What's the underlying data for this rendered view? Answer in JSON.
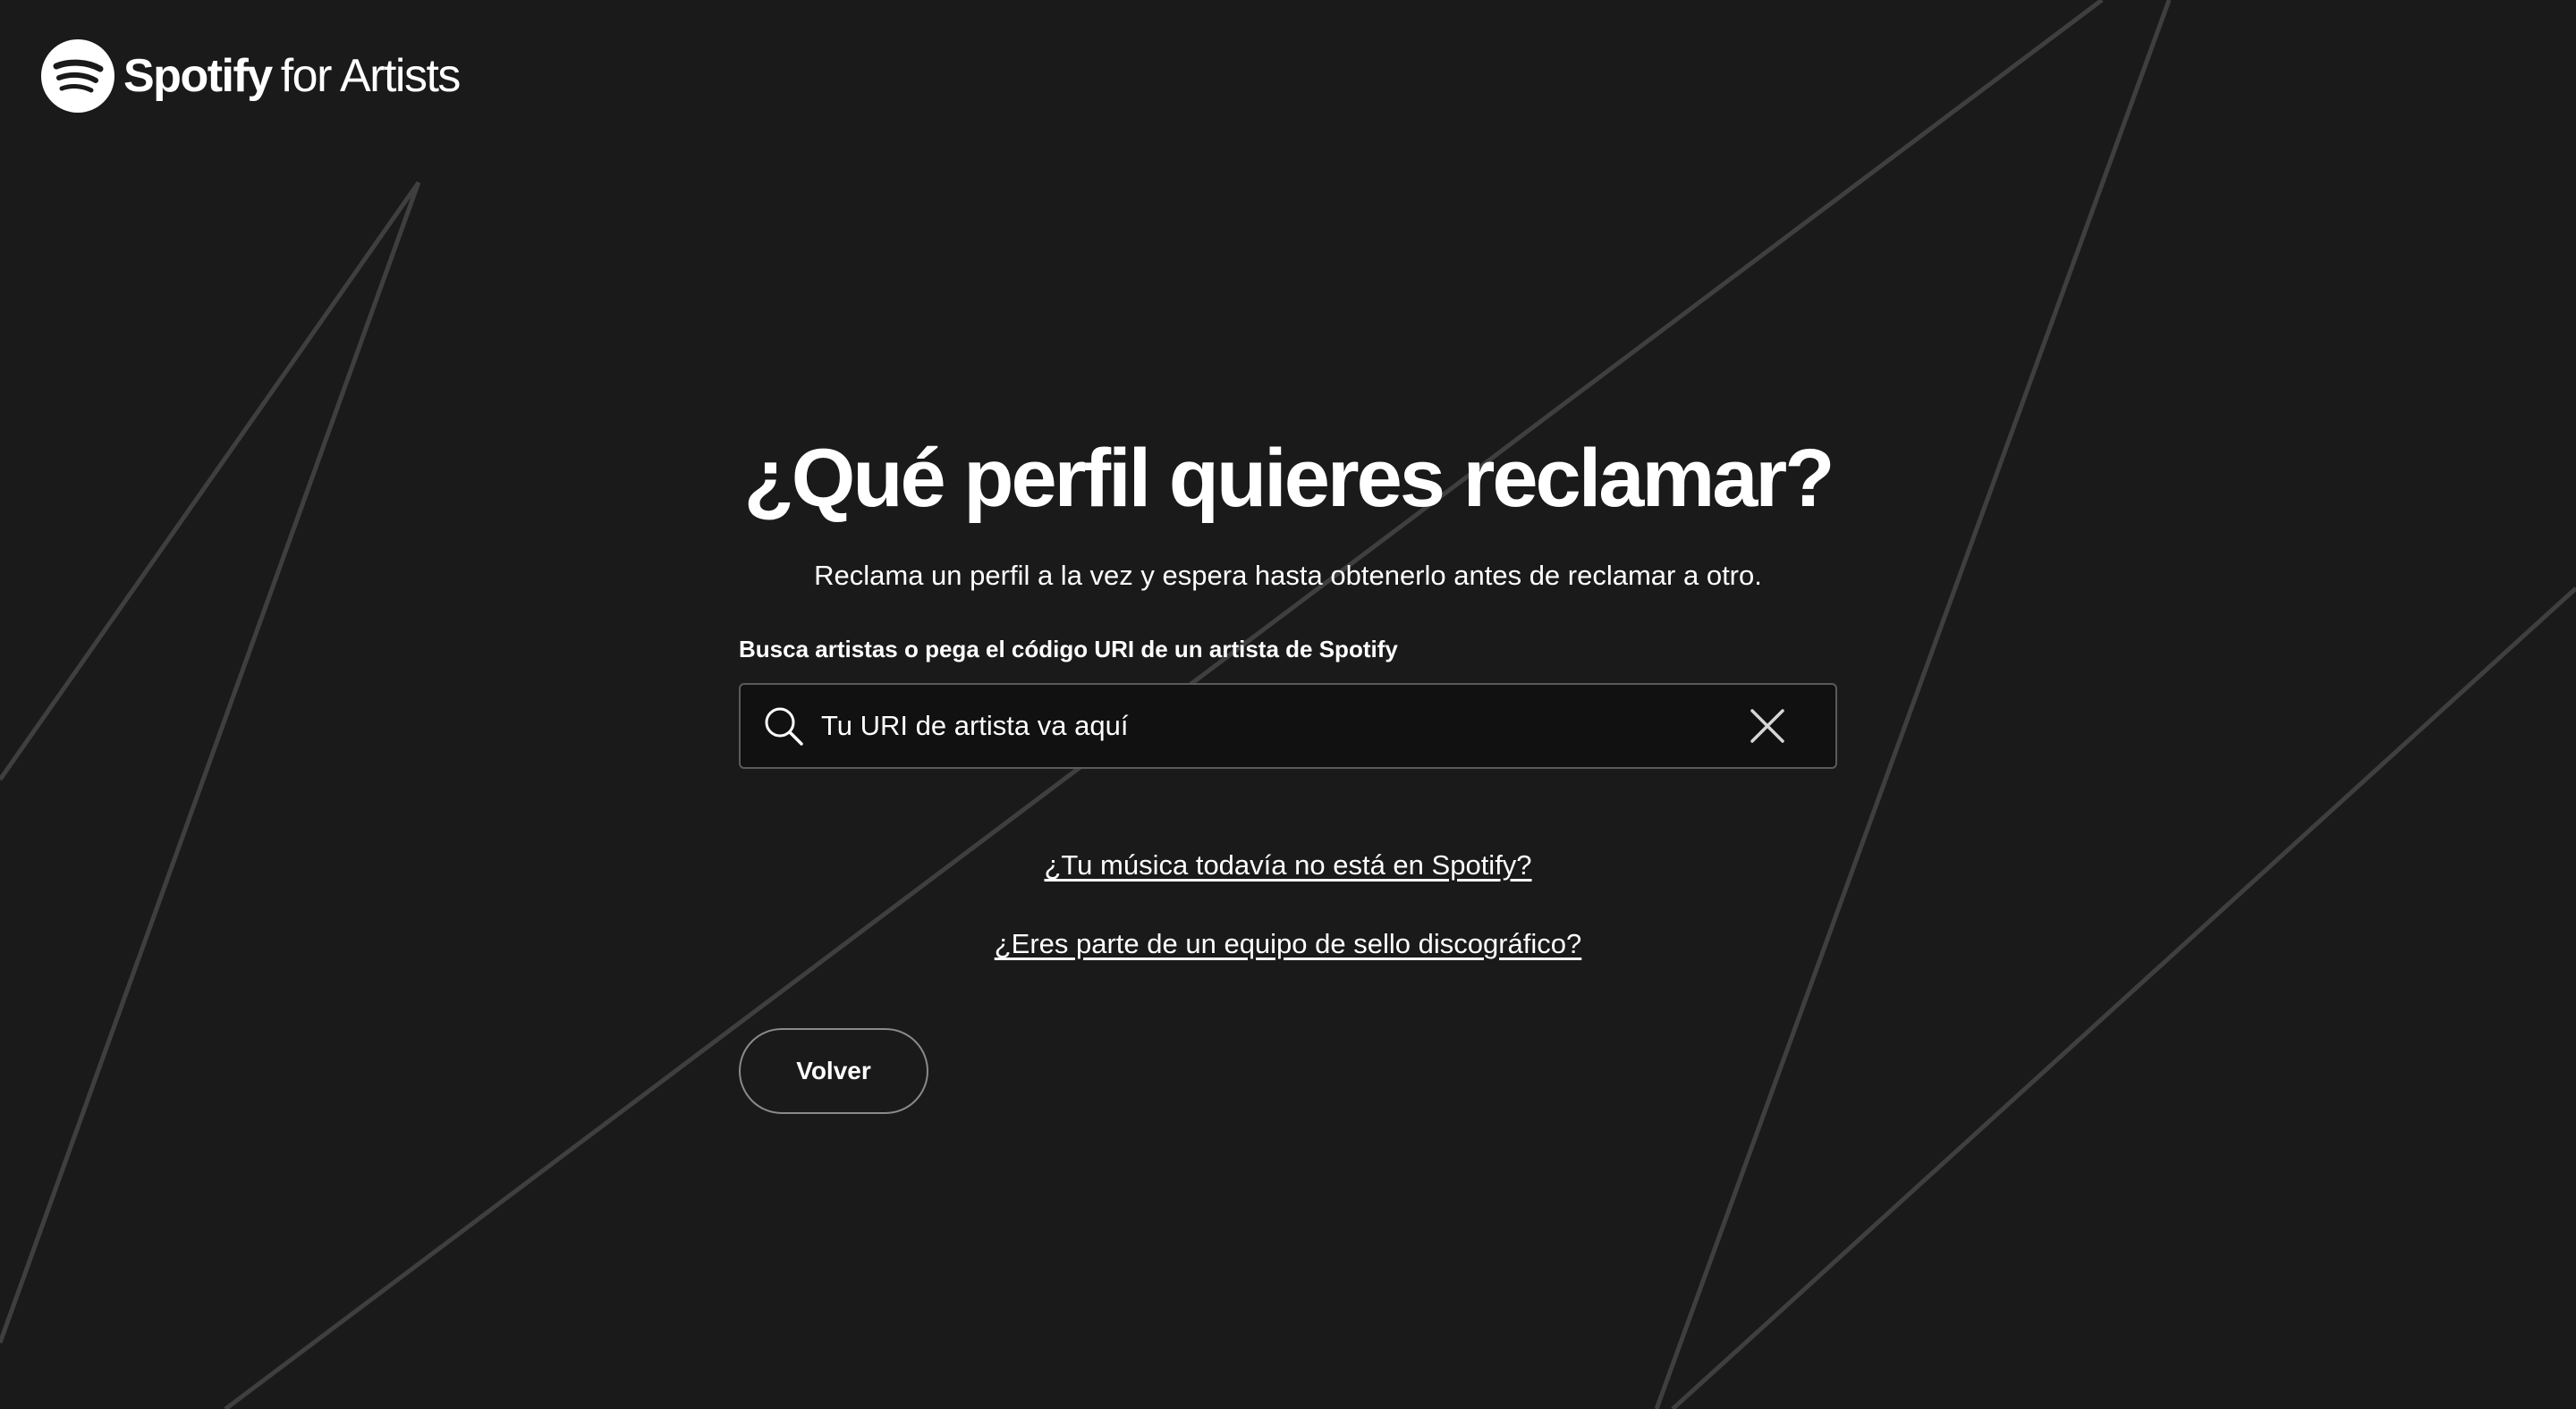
{
  "header": {
    "brand_name": "Spotify",
    "brand_suffix": "for Artists"
  },
  "main": {
    "title": "¿Qué perfil quieres reclamar?",
    "subtitle": "Reclama un perfil a la vez y espera hasta obtenerlo antes de reclamar a otro.",
    "search": {
      "label": "Busca artistas o pega el código URI de un artista de Spotify",
      "placeholder": "Tu URI de artista va aquí",
      "value": ""
    },
    "links": [
      "¿Tu música todavía no está en Spotify?",
      "¿Eres parte de un equipo de sello discográfico?"
    ],
    "back_button_label": "Volver"
  },
  "colors": {
    "background": "#1a1a1a",
    "text": "#ffffff",
    "input_background": "#111111",
    "input_border": "#5a5a5a",
    "decorative_lines": "#3f3f3f"
  },
  "icons": {
    "logo": "spotify-logo-icon",
    "search": "search-icon",
    "clear": "close-icon"
  }
}
